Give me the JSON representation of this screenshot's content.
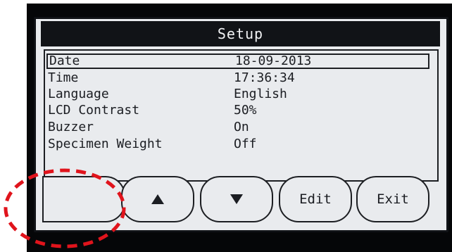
{
  "screen": {
    "title": "Setup",
    "settings": [
      {
        "label": "Date",
        "value": "18-09-2013",
        "selected": true
      },
      {
        "label": "Time",
        "value": "17:36:34",
        "selected": false
      },
      {
        "label": "Language",
        "value": "English",
        "selected": false
      },
      {
        "label": "LCD Contrast",
        "value": "50%",
        "selected": false
      },
      {
        "label": "Buzzer",
        "value": "On",
        "selected": false
      },
      {
        "label": "Specimen Weight",
        "value": "Off",
        "selected": false
      }
    ]
  },
  "softkeys": {
    "up_icon": "triangle-up-icon",
    "down_icon": "triangle-down-icon",
    "edit_label": "Edit",
    "exit_label": "Exit"
  },
  "annotation": {
    "shape": "dashed-ellipse",
    "color": "#e0141c"
  },
  "colors": {
    "lcd_background": "#e9ebee",
    "lcd_text": "#1b1d22",
    "title_bar": "#111317",
    "bezel": "#050608"
  }
}
